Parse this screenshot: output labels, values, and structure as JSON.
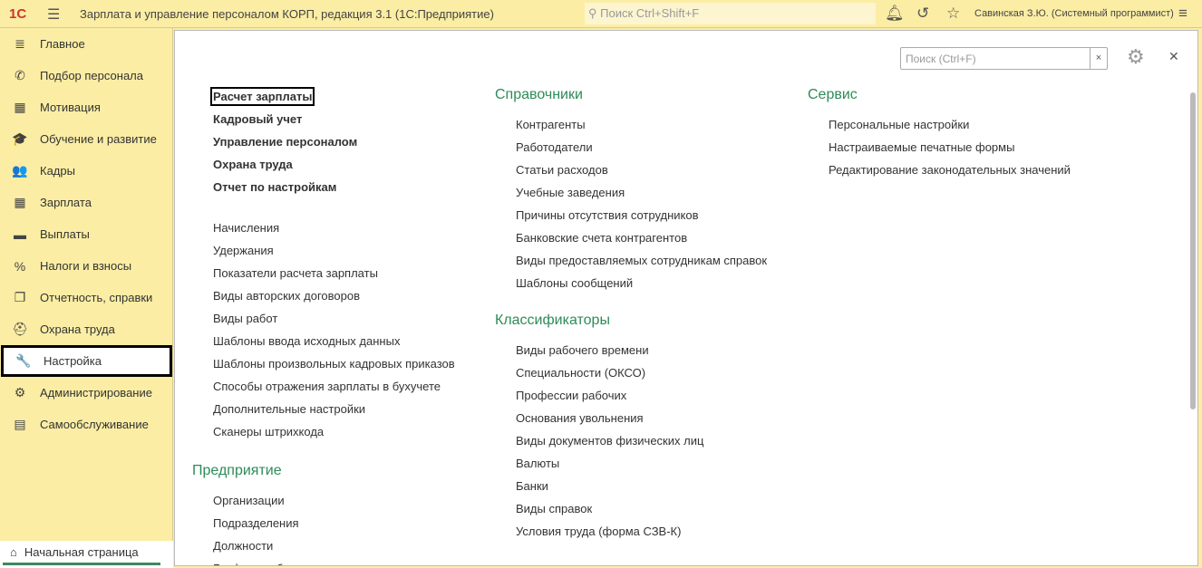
{
  "header": {
    "logo": "1С",
    "title": "Зарплата и управление персоналом КОРП, редакция 3.1  (1С:Предприятие)",
    "search_placeholder": "Поиск Ctrl+Shift+F",
    "user": "Савинская З.Ю. (Системный программист)"
  },
  "sidebar": {
    "items": [
      {
        "label": "Главное",
        "icon": "≣"
      },
      {
        "label": "Подбор персонала",
        "icon": "✆"
      },
      {
        "label": "Мотивация",
        "icon": "▦"
      },
      {
        "label": "Обучение и развитие",
        "icon": "🎓"
      },
      {
        "label": "Кадры",
        "icon": "👥"
      },
      {
        "label": "Зарплата",
        "icon": "▦"
      },
      {
        "label": "Выплаты",
        "icon": "▬"
      },
      {
        "label": "Налоги и взносы",
        "icon": "%"
      },
      {
        "label": "Отчетность, справки",
        "icon": "❐"
      },
      {
        "label": "Охрана труда",
        "icon": "⛑"
      },
      {
        "label": "Настройка",
        "icon": "🔧"
      },
      {
        "label": "Администрирование",
        "icon": "⚙"
      },
      {
        "label": "Самообслуживание",
        "icon": "▤"
      }
    ],
    "selected": "Настройка"
  },
  "bottom_tab": {
    "label": "Начальная страница"
  },
  "content": {
    "search_placeholder": "Поиск (Ctrl+F)",
    "col1_bold": [
      "Расчет зарплаты",
      "Кадровый учет",
      "Управление персоналом",
      "Охрана труда",
      "Отчет по настройкам"
    ],
    "col1_links": [
      "Начисления",
      "Удержания",
      "Показатели расчета зарплаты",
      "Виды авторских договоров",
      "Виды работ",
      "Шаблоны ввода исходных данных",
      "Шаблоны произвольных кадровых приказов",
      "Способы отражения зарплаты в бухучете",
      "Дополнительные настройки",
      "Сканеры штрихкода"
    ],
    "enterprise": {
      "title": "Предприятие",
      "items": [
        "Организации",
        "Подразделения",
        "Должности",
        "Графики работы"
      ]
    },
    "references": {
      "title": "Справочники",
      "items": [
        "Контрагенты",
        "Работодатели",
        "Статьи расходов",
        "Учебные заведения",
        "Причины отсутствия сотрудников",
        "Банковские счета контрагентов",
        "Виды предоставляемых сотрудникам справок",
        "Шаблоны сообщений"
      ]
    },
    "classifiers": {
      "title": "Классификаторы",
      "items": [
        "Виды рабочего времени",
        "Специальности (ОКСО)",
        "Профессии рабочих",
        "Основания увольнения",
        "Виды документов физических лиц",
        "Валюты",
        "Банки",
        "Виды справок",
        "Условия труда (форма СЗВ-К)"
      ]
    },
    "service": {
      "title": "Сервис",
      "items": [
        "Персональные настройки",
        "Настраиваемые печатные формы",
        "Редактирование законодательных значений"
      ]
    }
  }
}
